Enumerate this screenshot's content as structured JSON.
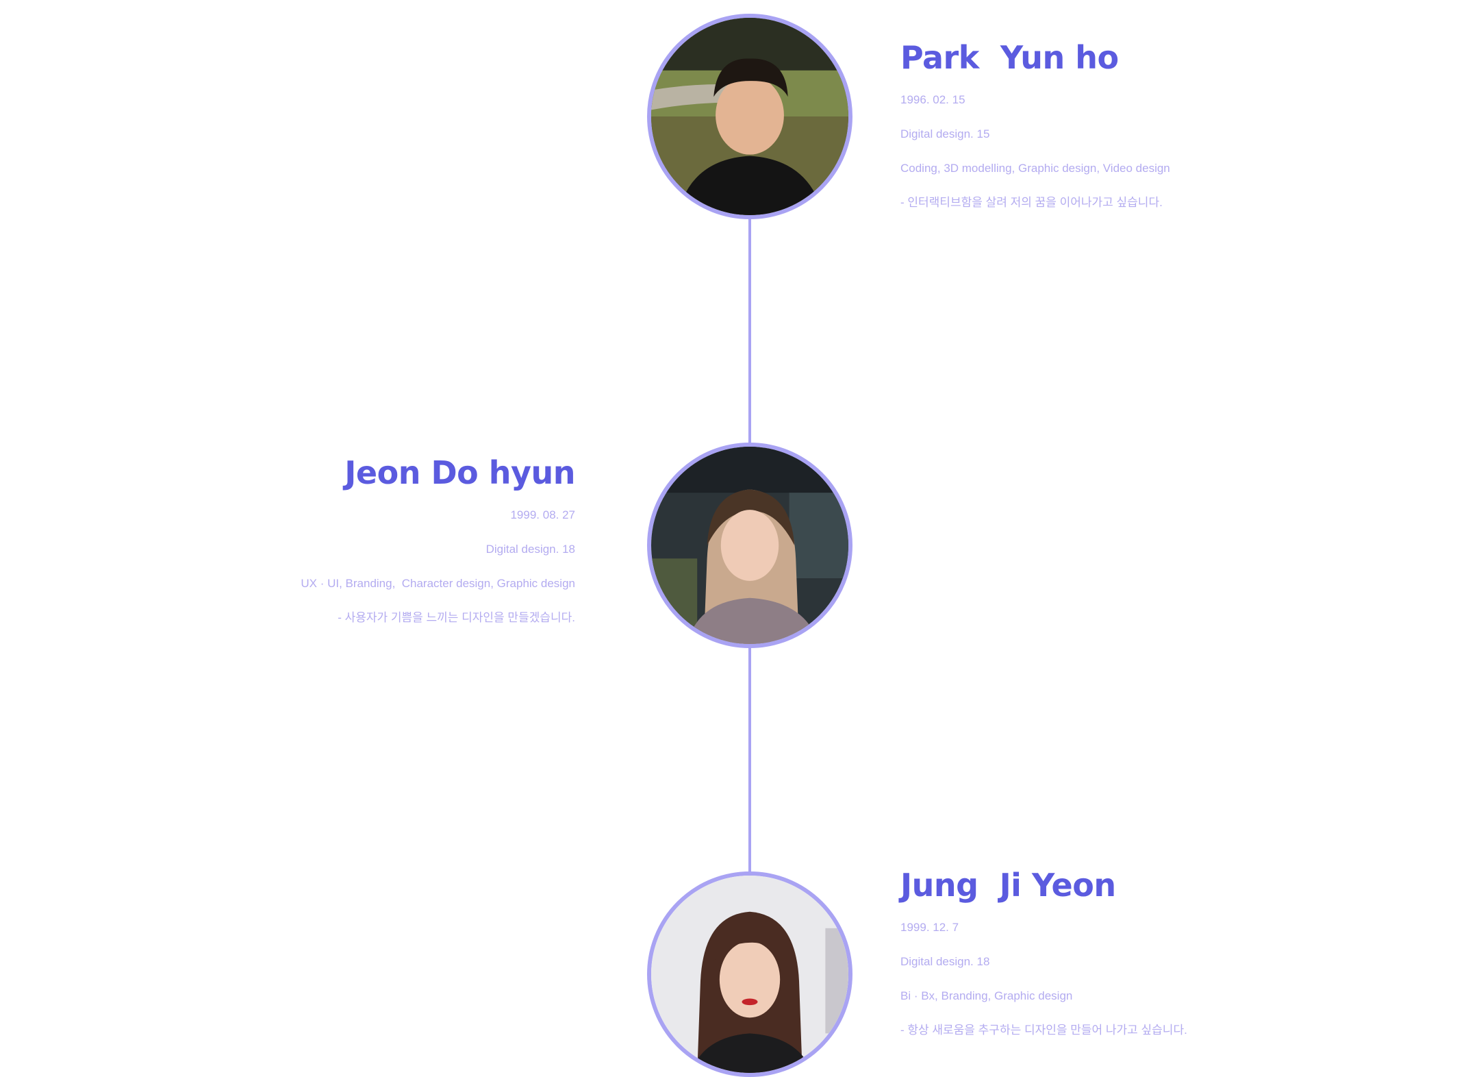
{
  "colors": {
    "accent": "#5b5bdf",
    "text_light": "#b3abf0",
    "timeline": "#a9a3f3",
    "background": "#ffffff"
  },
  "members": [
    {
      "name": "Park  Yun ho",
      "birth": "1996. 02. 15",
      "dept": "Digital design. 15",
      "skills": "Coding, 3D modelling, Graphic design, Video design",
      "motto": "- 인터랙티브함을 살려 저의 꿈을 이어나가고 싶습니다."
    },
    {
      "name": "Jeon Do hyun",
      "birth": "1999. 08. 27",
      "dept": "Digital design. 18",
      "skills": "UX · UI, Branding,  Character design, Graphic design",
      "motto": "- 사용자가 기쁨을 느끼는 디자인을 만들겠습니다."
    },
    {
      "name": "Jung  Ji Yeon",
      "birth": "1999. 12. 7",
      "dept": "Digital design. 18",
      "skills": "Bi · Bx, Branding, Graphic design",
      "motto": "- 항상 새로움을 추구하는 디자인을 만들어 나가고 싶습니다."
    }
  ]
}
